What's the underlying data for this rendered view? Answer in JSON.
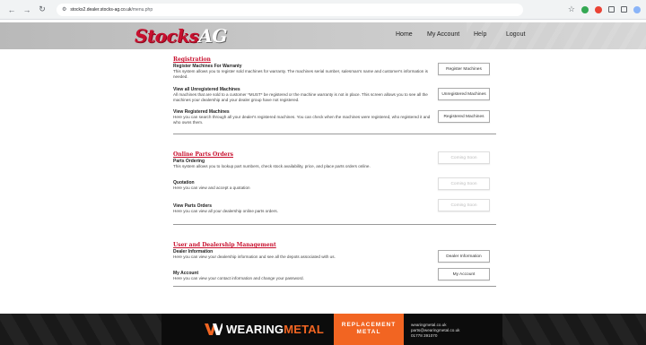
{
  "browser": {
    "url_domain": "stocks2.dealer.stocks-ag.co.uk",
    "url_path": "/menu.php"
  },
  "site": {
    "logo_main": "Stocks",
    "logo_suffix": "AG",
    "nav": [
      "Home",
      "My Account",
      "Help",
      "Logout"
    ]
  },
  "registration": {
    "title": "Registration",
    "items": [
      {
        "title": "Register Machines For Warranty",
        "desc": "This system allows you to register sold machines for warranty. The machines serial number, salesman's name and customer's information is needed.",
        "button": "Register Machines",
        "enabled": true
      },
      {
        "title": "View all Unregistered Machines",
        "desc": "All machines that are sold to a customer *MUST* be registered or the machine warranty is not in place. This screen allows you to see all the machines your dealership and your dealer group have not registered.",
        "button": "Unregistered Machines",
        "enabled": true
      },
      {
        "title": "View Registered Machines",
        "desc": "Here you can search through all your dealer's registered machines. You can check when the machines were registered, who registered it and who owns them.",
        "button": "Registered Machines",
        "enabled": true
      }
    ]
  },
  "parts": {
    "title": "Online Parts Orders",
    "items": [
      {
        "title": "Parts Ordering",
        "desc": "This system allows you to lookup part numbers, check stock availability, price, and place parts orders online.",
        "button": "Coming Soon",
        "enabled": false
      },
      {
        "title": "Quotation",
        "desc": "Here you can view and accept a quotation",
        "button": "Coming Soon",
        "enabled": false
      },
      {
        "title": "View Parts Orders",
        "desc": "Here you can view all your dealership online parts orders.",
        "button": "Coming Soon",
        "enabled": false
      }
    ]
  },
  "dealer": {
    "title": "User and Dealership Management",
    "items": [
      {
        "title": "Dealer Information",
        "desc": "Here you can view your dealership information and see all the depots associated with us.",
        "button": "Dealer Information",
        "enabled": true
      },
      {
        "title": "My Account",
        "desc": "Here you can view your contact information and change your password.",
        "button": "My Account",
        "enabled": true
      }
    ]
  },
  "footer": {
    "brand_main": "WEARING",
    "brand_accent": "METAL",
    "replacement_line1": "REPLACEMENT",
    "replacement_line2": "METAL",
    "contact": [
      "wearingmetal.co.uk",
      "parts@wearingmetal.co.uk",
      "01778 391070"
    ]
  },
  "colors": {
    "brand_red": "#c8102e",
    "footer_orange": "#f26522"
  }
}
